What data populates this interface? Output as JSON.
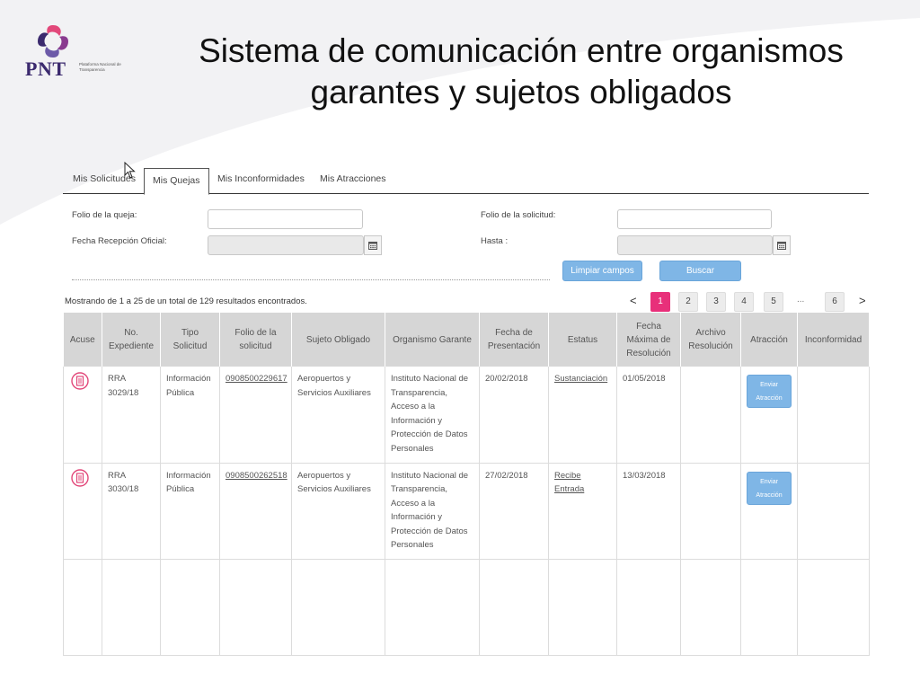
{
  "logo": {
    "text": "PNT",
    "subtitle": "Plataforma Nacional de Transparencia",
    "colors": [
      "#3b2a6e",
      "#8a3b8f",
      "#e2487a",
      "#6c5aa8"
    ]
  },
  "slide": {
    "title_line1": "Sistema de comunicación entre organismos",
    "title_line2": "garantes y sujetos obligados"
  },
  "tabs": [
    {
      "label": "Mis Solicitudes",
      "active": false
    },
    {
      "label": "Mis Quejas",
      "active": true
    },
    {
      "label": "Mis Inconformidades",
      "active": false
    },
    {
      "label": "Mis Atracciones",
      "active": false
    }
  ],
  "filters": {
    "folio_queja_label": "Folio de la queja:",
    "folio_queja_value": "",
    "folio_solicitud_label": "Folio de la solicitud:",
    "folio_solicitud_value": "",
    "fecha_label": "Fecha Recepción Oficial:",
    "fecha_value": "",
    "hasta_label": "Hasta :",
    "hasta_value": "",
    "calendar_icon": "calendar-icon"
  },
  "buttons": {
    "clear": "Limpiar campos",
    "search": "Buscar"
  },
  "results_text": "Mostrando de 1 a 25 de un total de 129 resultados encontrados.",
  "pagination": {
    "prev": "<",
    "next": ">",
    "pages": [
      "1",
      "2",
      "3",
      "4",
      "5"
    ],
    "ellipsis": "...",
    "last": "6",
    "current": "1",
    "active_color": "#e8307a"
  },
  "table": {
    "headers": {
      "acuse": "Acuse",
      "expediente": "No. Expediente",
      "tipo": "Tipo Solicitud",
      "folio": "Folio de la solicitud",
      "sujeto": "Sujeto Obligado",
      "organismo": "Organismo Garante",
      "fecha_presentacion": "Fecha de Presentación",
      "estatus": "Estatus",
      "fecha_maxima": "Fecha Máxima de Resolución",
      "archivo": "Archivo Resolución",
      "atraccion": "Atracción",
      "inconformidad": "Inconformidad"
    },
    "rows": [
      {
        "expediente": "RRA 3029/18",
        "tipo": "Información Pública",
        "folio": "0908500229617",
        "sujeto": "Aeropuertos y Servicios Auxiliares",
        "organismo": "Instituto Nacional de Transparencia, Acceso a la Información y Protección de Datos Personales",
        "fecha_presentacion": "20/02/2018",
        "estatus": "Sustanciación",
        "fecha_maxima": "01/05/2018",
        "archivo": "",
        "atraccion_button": "Enviar Atracción",
        "inconformidad": ""
      },
      {
        "expediente": "RRA 3030/18",
        "tipo": "Información Pública",
        "folio": "0908500262518",
        "sujeto": "Aeropuertos y Servicios Auxiliares",
        "organismo": "Instituto Nacional de Transparencia, Acceso a la Información y Protección de Datos Personales",
        "fecha_presentacion": "27/02/2018",
        "estatus": "Recibe Entrada",
        "fecha_maxima": "13/03/2018",
        "archivo": "",
        "atraccion_button": "Enviar Atracción",
        "inconformidad": ""
      }
    ]
  },
  "colors": {
    "accent_button": "#7fb6e6",
    "header_bg": "#d6d6d6",
    "ack_icon": "#e2487a"
  }
}
